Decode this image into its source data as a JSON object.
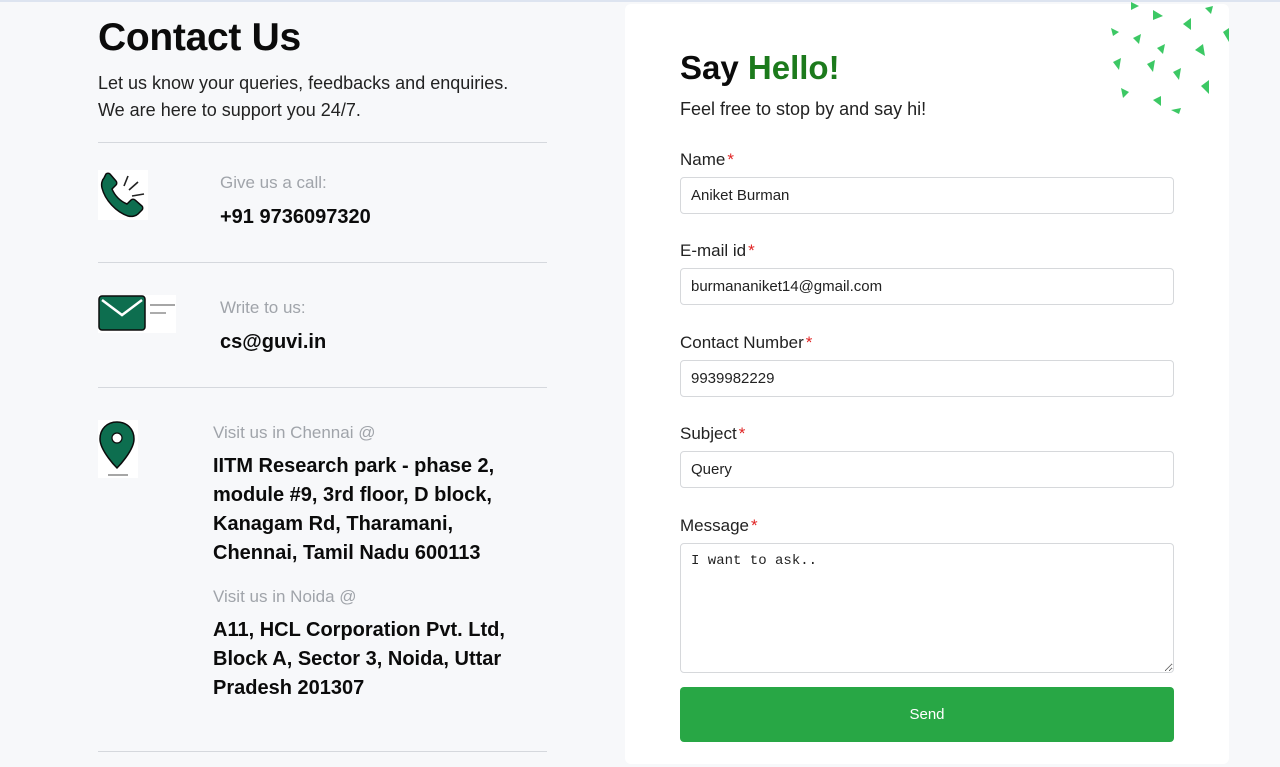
{
  "contact": {
    "title": "Contact Us",
    "intro_line1": "Let us know your queries, feedbacks and enquiries.",
    "intro_line2": "We are here to support you 24/7.",
    "call_label": "Give us a call:",
    "call_value": "+91 9736097320",
    "write_label": "Write to us:",
    "write_value": "cs@guvi.in",
    "chennai_label": "Visit us in Chennai @",
    "chennai_address": "IITM Research park - phase 2, module #9, 3rd floor, D block, Kanagam Rd, Tharamani, Chennai, Tamil Nadu 600113",
    "noida_label": "Visit us in Noida @",
    "noida_address": "A11, HCL Corporation Pvt. Ltd, Block A, Sector 3, Noida, Uttar Pradesh 201307"
  },
  "form": {
    "heading_prefix": "Say ",
    "heading_accent": "Hello!",
    "tagline": "Feel free to stop by and say hi!",
    "required_mark": "*",
    "name_label": "Name",
    "name_value": "Aniket Burman",
    "email_label": "E-mail id",
    "email_value": "burmananiket14@gmail.com",
    "contact_label": "Contact Number",
    "contact_value": "9939982229",
    "subject_label": "Subject",
    "subject_value": "Query",
    "message_label": "Message",
    "message_value": "I want to ask..",
    "send_label": "Send"
  },
  "icons": [
    "phone-icon",
    "envelope-icon",
    "location-pin-icon",
    "decorative-triangles"
  ],
  "colors": {
    "brand_dark_green": "#0d6e4f",
    "accent_green": "#1c7a1c",
    "button_green": "#28a745",
    "required_red": "#e02424",
    "deco_green": "#3cc864"
  }
}
